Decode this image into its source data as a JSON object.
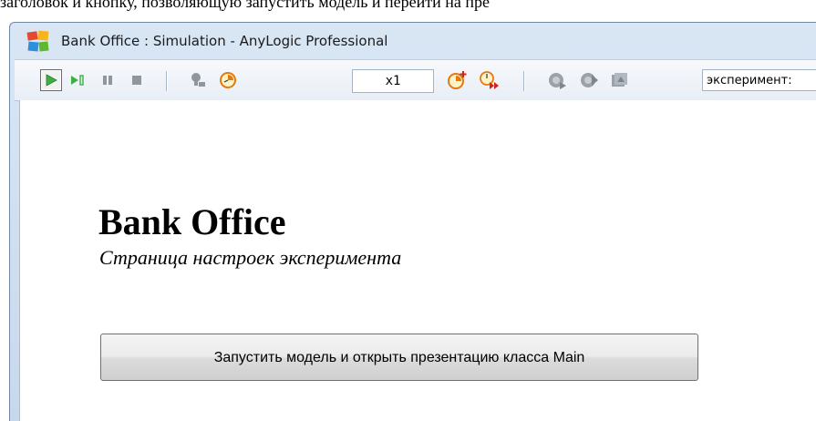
{
  "doc_strip_text": "заголовок и кнопку, позволяющую запустить модель и перейти на пре",
  "window": {
    "title": "Bank Office : Simulation - AnyLogic Professional"
  },
  "toolbar": {
    "buttons": [
      {
        "name": "run-button",
        "icon": "play-icon"
      },
      {
        "name": "step-button",
        "icon": "step-icon"
      },
      {
        "name": "pause-button",
        "icon": "pause-icon"
      },
      {
        "name": "stop-button",
        "icon": "stop-icon"
      },
      {
        "name": "real-time-mode-button",
        "icon": "turtle-icon"
      },
      {
        "name": "slow-down-button",
        "icon": "clock-slow-icon"
      },
      {
        "name": "speed-up-button",
        "icon": "clock-fast-icon"
      },
      {
        "name": "virtual-time-button",
        "icon": "clock-virtual-icon"
      },
      {
        "name": "navigate-back-button",
        "icon": "nav-back-icon"
      },
      {
        "name": "navigate-up-button",
        "icon": "nav-up-icon"
      },
      {
        "name": "navigate-home-button",
        "icon": "nav-home-icon"
      }
    ],
    "speed_value": "x1",
    "experiment_select_value": "эксперимент:"
  },
  "content": {
    "title": "Bank Office",
    "subtitle": "Страница настроек эксперимента",
    "run_button_label": "Запустить модель и открыть презентацию класса Main"
  },
  "colors": {
    "play_green": "#3cb043",
    "gray_icon": "#8f969e",
    "clock_orange": "#e07b12",
    "clock_red": "#d2231b"
  }
}
